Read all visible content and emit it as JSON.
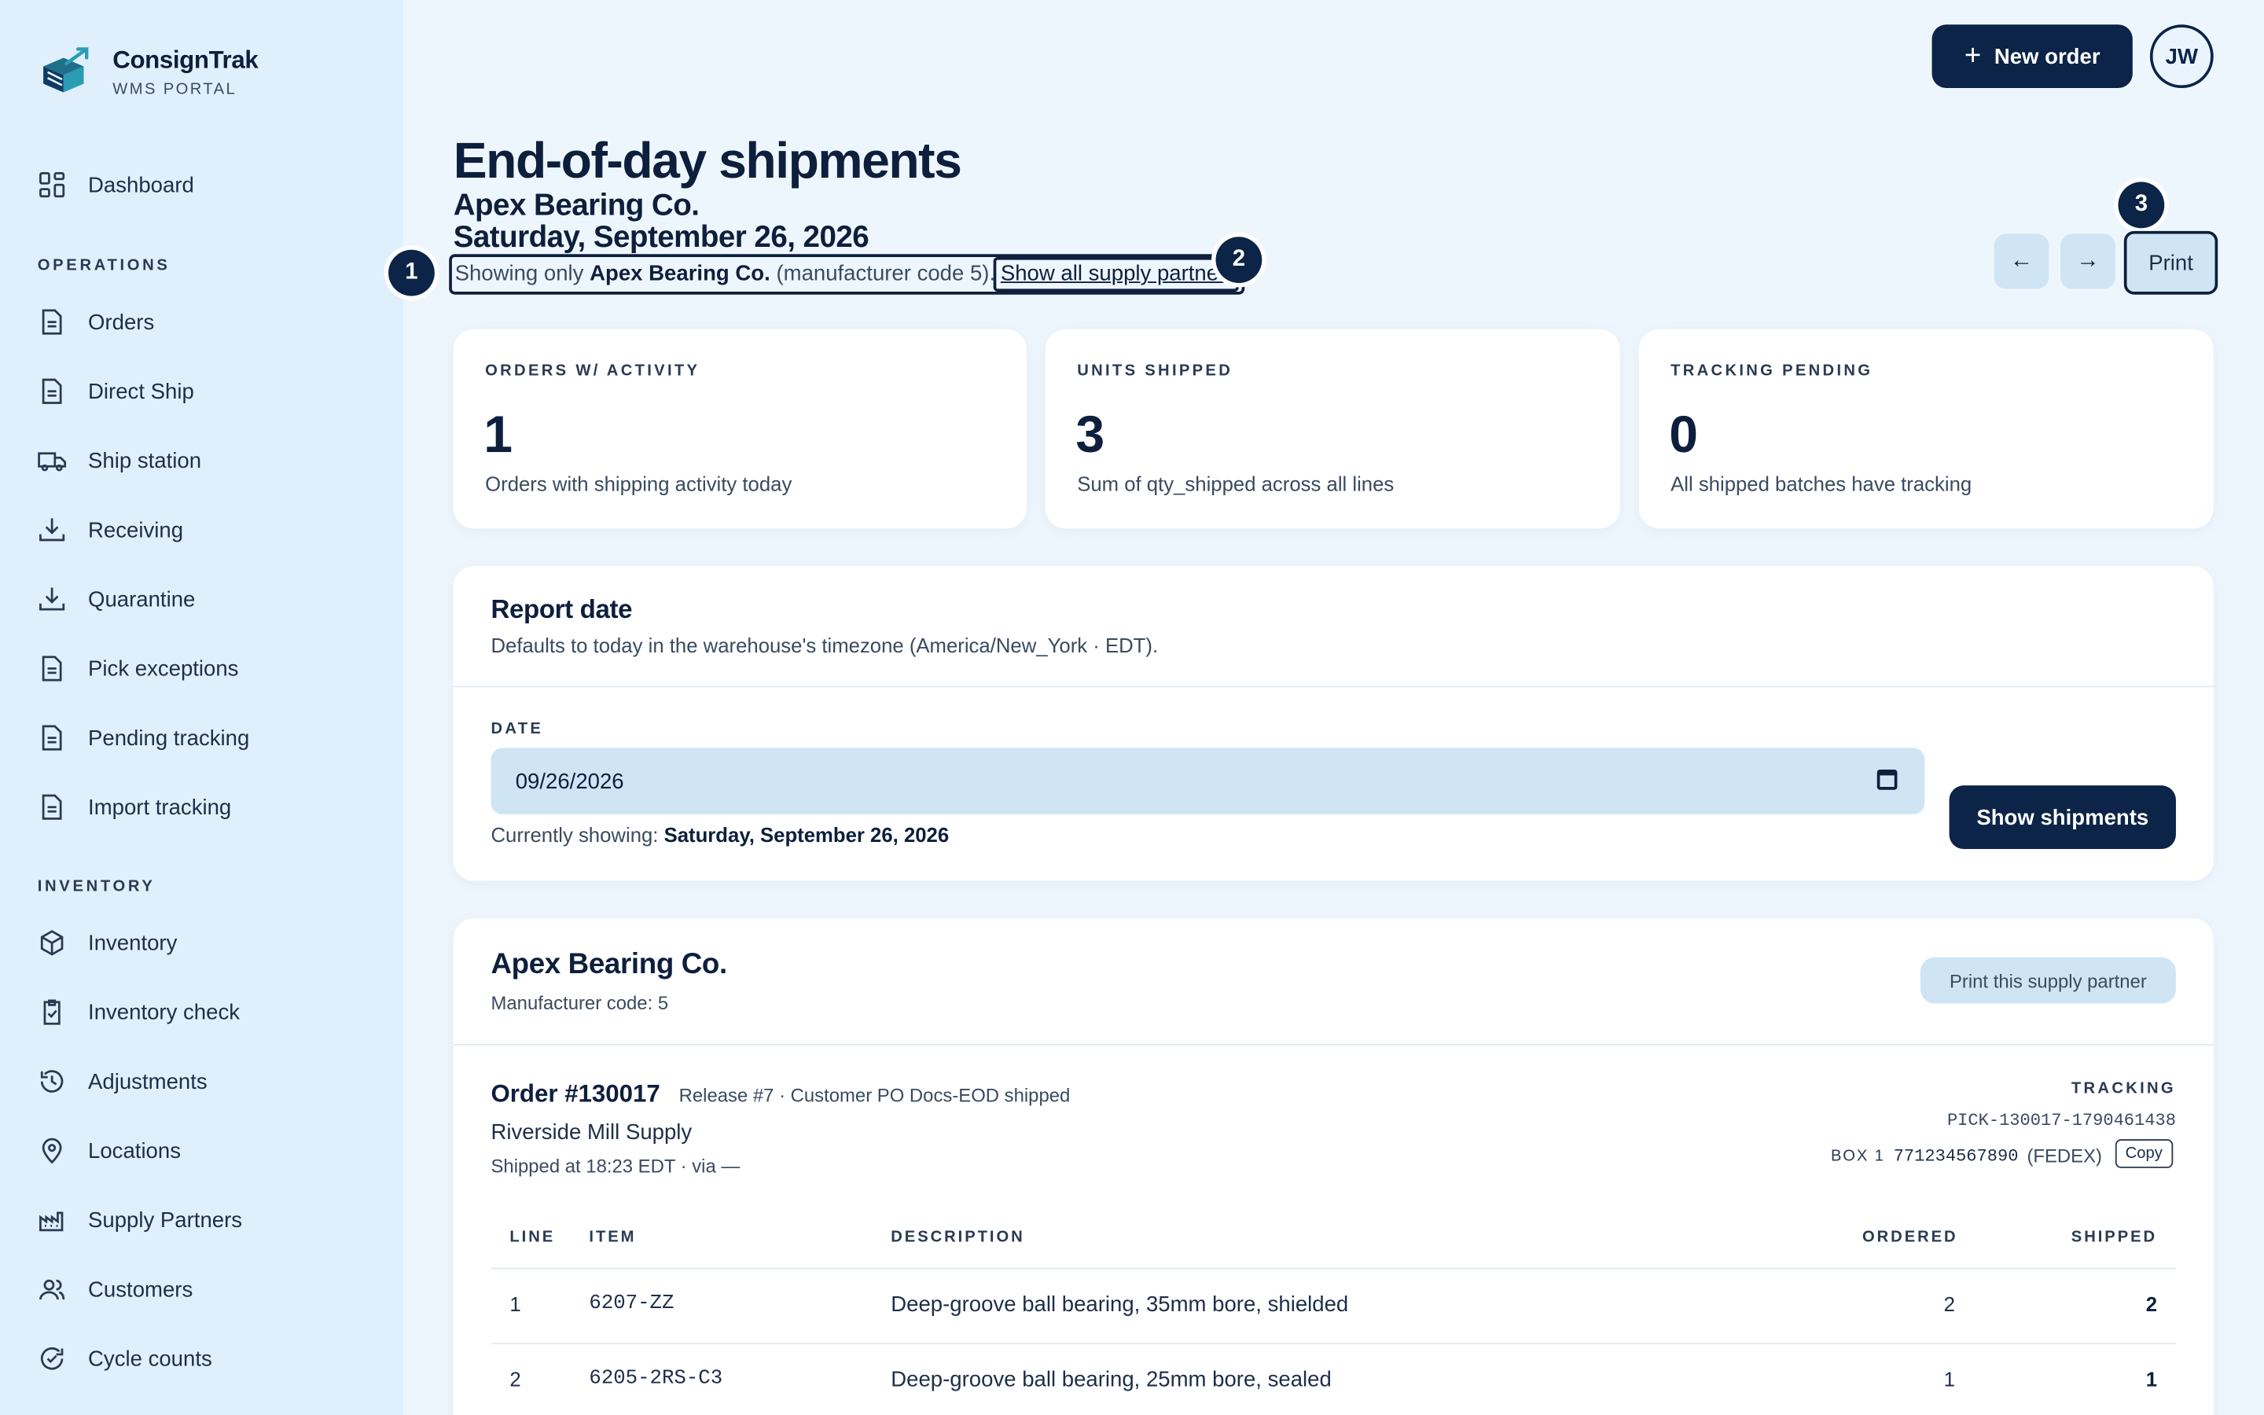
{
  "app": {
    "name": "ConsignTrak",
    "subtitle": "WMS PORTAL"
  },
  "sidebar": {
    "top_items": [
      {
        "label": "Dashboard",
        "icon": "grid-icon"
      }
    ],
    "operations_heading": "OPERATIONS",
    "operations": [
      {
        "label": "Orders",
        "icon": "document-icon"
      },
      {
        "label": "Direct Ship",
        "icon": "document-icon"
      },
      {
        "label": "Ship station",
        "icon": "truck-icon"
      },
      {
        "label": "Receiving",
        "icon": "download-icon"
      },
      {
        "label": "Quarantine",
        "icon": "download-icon"
      },
      {
        "label": "Pick exceptions",
        "icon": "document-icon"
      },
      {
        "label": "Pending tracking",
        "icon": "document-icon"
      },
      {
        "label": "Import tracking",
        "icon": "document-icon"
      }
    ],
    "inventory_heading": "INVENTORY",
    "inventory": [
      {
        "label": "Inventory",
        "icon": "box-icon"
      },
      {
        "label": "Inventory check",
        "icon": "clipboard-check-icon"
      },
      {
        "label": "Adjustments",
        "icon": "history-icon"
      },
      {
        "label": "Locations",
        "icon": "map-pin-icon"
      },
      {
        "label": "Supply Partners",
        "icon": "factory-icon"
      },
      {
        "label": "Customers",
        "icon": "users-icon"
      },
      {
        "label": "Cycle counts",
        "icon": "refresh-check-icon"
      }
    ]
  },
  "header": {
    "new_order_label": "New order",
    "avatar_initials": "JW"
  },
  "page": {
    "title": "End-of-day shipments",
    "partner": "Apex Bearing Co.",
    "date_heading": "Saturday, September 26, 2026",
    "filter_prefix": "Showing only ",
    "filter_partner": "Apex Bearing Co.",
    "filter_suffix": " (manufacturer code 5).",
    "show_all_link": "Show all supply partners",
    "prev_label": "←",
    "next_label": "→",
    "print_label": "Print",
    "markers": [
      "1",
      "2",
      "3"
    ]
  },
  "stats": [
    {
      "label": "ORDERS W/ ACTIVITY",
      "value": "1",
      "desc": "Orders with shipping activity today"
    },
    {
      "label": "UNITS SHIPPED",
      "value": "3",
      "desc": "Sum of qty_shipped across all lines"
    },
    {
      "label": "TRACKING PENDING",
      "value": "0",
      "desc": "All shipped batches have tracking"
    }
  ],
  "report_date": {
    "title": "Report date",
    "desc": "Defaults to today in the warehouse's timezone (America/New_York · EDT).",
    "field_label": "DATE",
    "value": "09/26/2026",
    "currently_prefix": "Currently showing: ",
    "currently_value": "Saturday, September 26, 2026",
    "button_label": "Show shipments"
  },
  "partner_section": {
    "name": "Apex Bearing Co.",
    "code_text": "Manufacturer code: 5",
    "print_label": "Print this supply partner",
    "order": {
      "number": "Order #130017",
      "meta": "Release #7 · Customer PO Docs-EOD shipped",
      "customer": "Riverside Mill Supply",
      "shipped_at": "Shipped at 18:23 EDT · via —",
      "tracking_label": "TRACKING",
      "pick_id": "PICK-130017-1790461438",
      "box_label": "BOX 1",
      "tracking_number": "771234567890",
      "carrier": "(FEDEX)",
      "copy_label": "Copy"
    },
    "columns": [
      "LINE",
      "ITEM",
      "DESCRIPTION",
      "ORDERED",
      "SHIPPED"
    ],
    "rows": [
      {
        "line": "1",
        "item": "6207-ZZ",
        "description": "Deep-groove ball bearing, 35mm bore, shielded",
        "ordered": "2",
        "shipped": "2"
      },
      {
        "line": "2",
        "item": "6205-2RS-C3",
        "description": "Deep-groove ball bearing, 25mm bore, sealed",
        "ordered": "1",
        "shipped": "1"
      }
    ]
  }
}
